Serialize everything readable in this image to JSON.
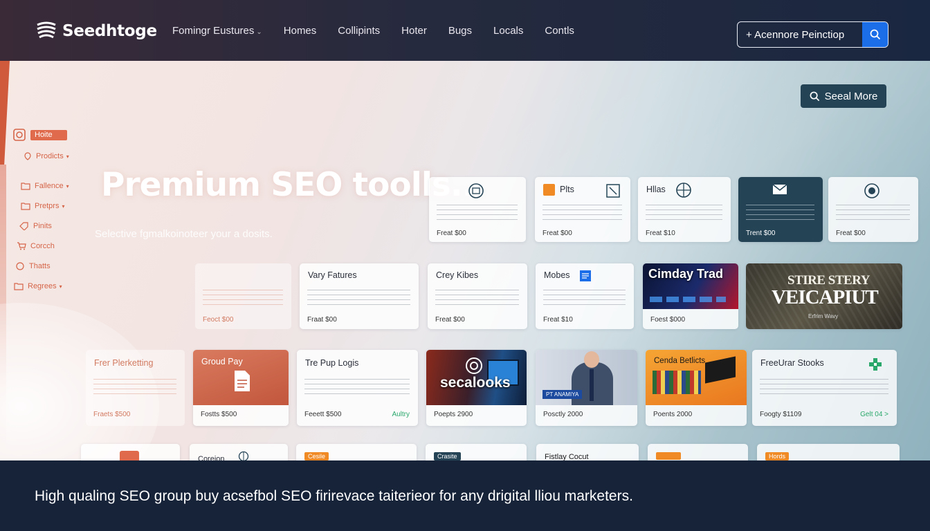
{
  "header": {
    "logo": "Seedhtoge",
    "nav": [
      {
        "label": "Fomingr Eustures",
        "has_chevron": true
      },
      {
        "label": "Homes"
      },
      {
        "label": "Collipints"
      },
      {
        "label": "Hoter"
      },
      {
        "label": "Bugs"
      },
      {
        "label": "Locals"
      },
      {
        "label": "Contls"
      }
    ],
    "cta": {
      "label": "+ Acennore Peinctiop",
      "icon": "search-icon"
    }
  },
  "sidebar": {
    "items": [
      {
        "label": "Hoite",
        "icon": "home-icon",
        "active": true
      },
      {
        "label": "Prodicts",
        "icon": "location-icon",
        "chevron": true
      },
      {
        "label": "Fallence",
        "icon": "folder-icon",
        "chevron": true
      },
      {
        "label": "Pretprs",
        "icon": "folder-icon",
        "chevron": true
      },
      {
        "label": "Pinits",
        "icon": "tag-icon"
      },
      {
        "label": "Corcch",
        "icon": "cart-icon"
      },
      {
        "label": "Thatts",
        "icon": "chat-icon"
      },
      {
        "label": "Regrees",
        "icon": "folder-icon",
        "chevron": true
      }
    ]
  },
  "hero": {
    "title": "Premium SEO toolls...",
    "subtitle": "Selective fgmalkoinoteer your a dosits.",
    "see_more": "Seeal More"
  },
  "cards": {
    "row1": [
      {
        "title": "",
        "price": "Freat $00",
        "icon": "globe-icon"
      },
      {
        "title": "Plts",
        "price": "Freat $00",
        "icon": "chart-icon"
      },
      {
        "title": "Hllas",
        "price": "Freat $10",
        "icon": "compass-icon"
      },
      {
        "title": "",
        "price": "Trent $00",
        "icon": "mail-icon",
        "dark": true
      },
      {
        "title": "",
        "price": "Freat $00",
        "icon": "info-icon"
      }
    ],
    "row2": [
      {
        "title": "",
        "price": "Feoct $00",
        "faint": true
      },
      {
        "title": "Vary Fatures",
        "price": "Fraat $00"
      },
      {
        "title": "Crey Kibes",
        "price": "Freat $00"
      },
      {
        "title": "Mobes",
        "price": "Freat $10",
        "icon": "document-icon"
      },
      {
        "title": "Cimday Trad",
        "price": "Foest $000",
        "thumb": "tech-image"
      },
      {
        "title": "STIRE STERY",
        "subtitle": "VEICAPIUT",
        "caption": "Erfrim Wavy",
        "thumb": "poster-image"
      }
    ],
    "row3": [
      {
        "title": "Frer Plerketting",
        "price": "Fraets $500",
        "faint": true
      },
      {
        "title": "Groud Pay",
        "price": "Fostts $500",
        "thumb": "doc-image"
      },
      {
        "title": "Tre Pup Logis",
        "price": "Feeett $500",
        "link": "Aultry"
      },
      {
        "title": "secalooks",
        "price": "Poepts 2900",
        "thumb": "laptop-image"
      },
      {
        "title": "PT ANAMIYA",
        "price": "Posctly 2000",
        "thumb": "person-image"
      },
      {
        "title": "Cenda Betlicts",
        "price": "Poents 2000",
        "thumb": "desk-image"
      },
      {
        "title": "FreeUrar Stooks",
        "price": "Foogty $1109",
        "link": "Gelt 04 >",
        "icon": "plus-icon"
      }
    ],
    "row4": [
      {
        "title": ""
      },
      {
        "title": "Coreion"
      },
      {
        "title": "Cesile"
      },
      {
        "title": "Crasite"
      },
      {
        "title": "Fistlay Cocut"
      },
      {
        "title": ""
      },
      {
        "title": "Hords"
      }
    ]
  },
  "footer": {
    "text": "High qualing SEO group buy acsefbol SEO firirevace taiterieor for any drigital lliou marketers."
  }
}
